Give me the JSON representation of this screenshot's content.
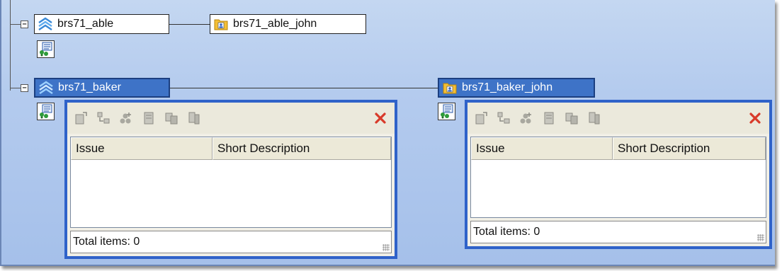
{
  "nodes": {
    "able": {
      "label": "brs71_able",
      "child_label": "brs71_able_john"
    },
    "baker": {
      "label": "brs71_baker",
      "child_label": "brs71_baker_john"
    }
  },
  "expander_symbol": "−",
  "panels": [
    {
      "columns": [
        "Issue",
        "Short Description"
      ],
      "footer": "Total items: 0"
    },
    {
      "columns": [
        "Issue",
        "Short Description"
      ],
      "footer": "Total items: 0"
    }
  ],
  "icons": {
    "node": "workspace-waves-icon",
    "child": "user-folder-icon",
    "small": "issue-list-icon",
    "toolbar": [
      "add-item-icon",
      "move-item-icon",
      "link-items-icon",
      "copy-item-icon",
      "duplicate-item-icon",
      "export-item-icon"
    ],
    "close": "close-x-icon"
  },
  "colors": {
    "selected_node": "#3e73c7",
    "panel_border": "#2f62c9",
    "canvas_bg": "#b4cbee",
    "close_red": "#d83a2a"
  }
}
